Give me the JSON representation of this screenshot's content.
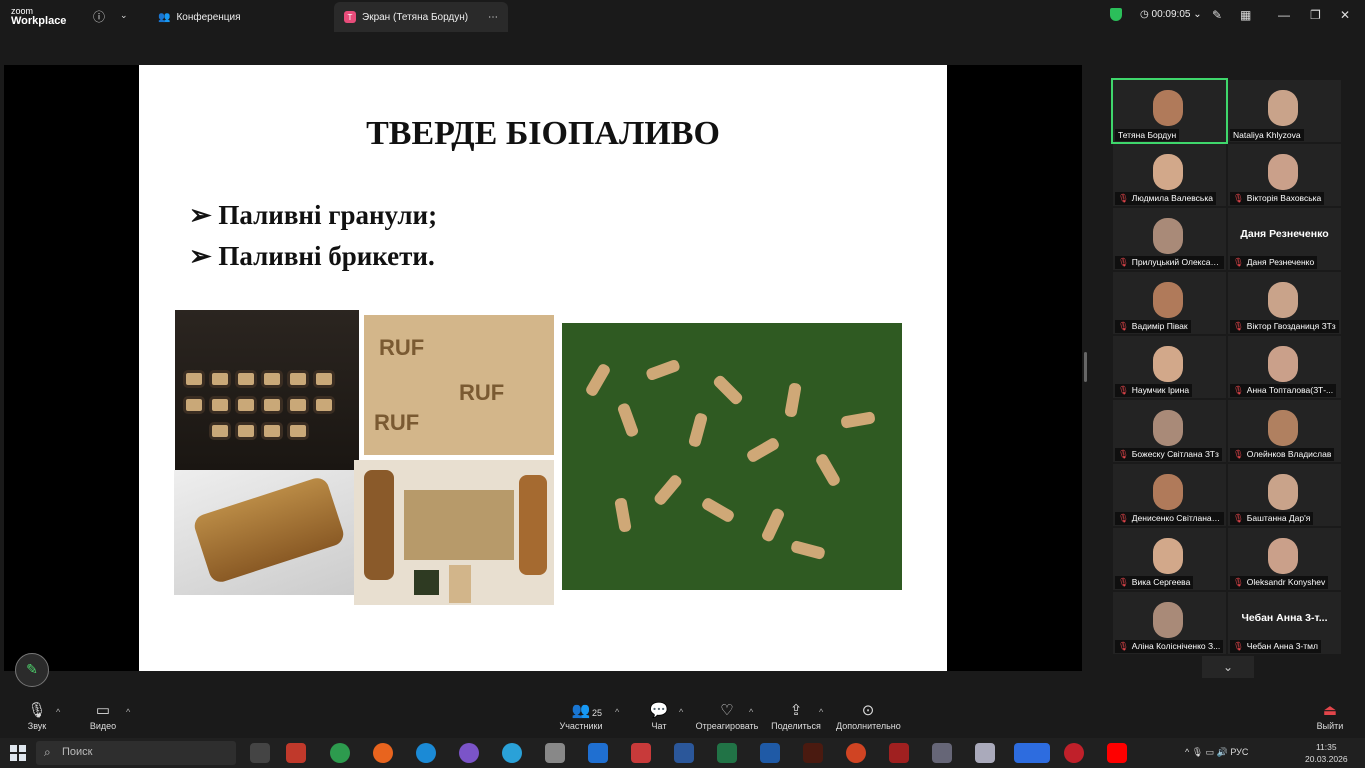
{
  "topbar": {
    "logo_top": "zoom",
    "logo_bottom": "Workplace",
    "conference_tab": "Конференция",
    "screen_tab": "Экран (Тетяна Бордун)",
    "screen_tab_badge": "T",
    "timer": "00:09:05",
    "accent": "#3fd76c"
  },
  "slide": {
    "title": "ТВЕРДЕ БІОПАЛИВО",
    "bullets": [
      "➢ Паливні гранули;",
      "➢ Паливні брикети."
    ],
    "brick_text": "RUF"
  },
  "participants": [
    {
      "name": "Тетяна Бордун",
      "muted": false,
      "video": true,
      "active": true
    },
    {
      "name": "Nataliya Khlyzova",
      "muted": false,
      "video": true
    },
    {
      "name": "Людмила Валевська",
      "muted": true,
      "video": true
    },
    {
      "name": "Вікторія Ваховська",
      "muted": true,
      "video": true
    },
    {
      "name": "Прилуцький Олексан...",
      "muted": true,
      "video": true
    },
    {
      "name": "Даня Резнеченко",
      "muted": true,
      "video": false
    },
    {
      "name": "Вадимір Півак",
      "muted": true,
      "video": true
    },
    {
      "name": "Віктор Гвозданиця ЗТз",
      "muted": true,
      "video": true
    },
    {
      "name": "Наумчик Ірина",
      "muted": true,
      "video": true
    },
    {
      "name": "Анна Топталова(ЗТ-...",
      "muted": true,
      "video": true
    },
    {
      "name": "Божеску Світлана ЗТз",
      "muted": true,
      "video": true
    },
    {
      "name": "Олейнков Владислав",
      "muted": true,
      "video": true
    },
    {
      "name": "Денисенко Світлана ...",
      "muted": true,
      "video": true
    },
    {
      "name": "Баштанна Дар'я",
      "muted": true,
      "video": true
    },
    {
      "name": "Вика Сергеева",
      "muted": true,
      "video": true
    },
    {
      "name": "Oleksandr Konyshev",
      "muted": true,
      "video": true
    },
    {
      "name": "Аліна Колісніченко З...",
      "muted": true,
      "video": true
    },
    {
      "name": "Чебан Анна 3-тмл",
      "muted": true,
      "video": false,
      "big_name": "Чебан Анна 3-т..."
    }
  ],
  "toolbar": {
    "audio": "Звук",
    "video": "Видео",
    "participants": "Участники",
    "participants_count": "25",
    "chat": "Чат",
    "react": "Отреагировать",
    "share": "Поделиться",
    "more": "Дополнительно",
    "leave": "Выйти"
  },
  "taskbar": {
    "search_placeholder": "Поиск",
    "lang": "РУС",
    "time": "11:35",
    "date": "20.03.2026"
  }
}
